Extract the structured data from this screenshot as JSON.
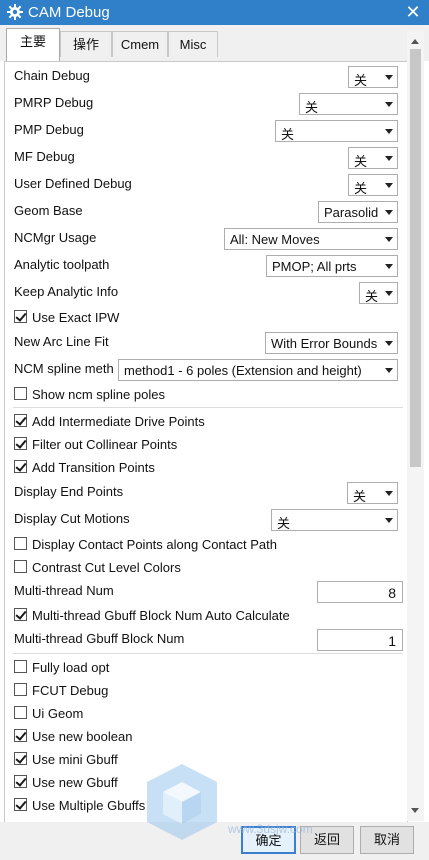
{
  "window": {
    "title": "CAM Debug",
    "accent": "#2f7fc9"
  },
  "tabs": [
    {
      "label": "主要",
      "active": true
    },
    {
      "label": "操作",
      "active": false
    },
    {
      "label": "Cmem",
      "active": false
    },
    {
      "label": "Misc",
      "active": false
    }
  ],
  "dropdown_rows": {
    "chain_debug": {
      "label": "Chain Debug",
      "value": "关"
    },
    "pmrp_debug": {
      "label": "PMRP Debug",
      "value": "关"
    },
    "pmp_debug": {
      "label": "PMP Debug",
      "value": "关"
    },
    "mf_debug": {
      "label": "MF Debug",
      "value": "关"
    },
    "user_defined_debug": {
      "label": "User Defined Debug",
      "value": "关"
    },
    "geom_base": {
      "label": "Geom Base",
      "value": "Parasolid"
    },
    "ncmgr_usage": {
      "label": "NCMgr Usage",
      "value": "All: New Moves"
    },
    "analytic_toolpath": {
      "label": "Analytic toolpath",
      "value": "PMOP; All prts"
    },
    "keep_analytic_info": {
      "label": "Keep Analytic Info",
      "value": "关"
    },
    "new_arc_line_fit": {
      "label": "New Arc Line Fit",
      "value": "With Error Bounds"
    },
    "ncm_spline_meth": {
      "label": "NCM spline meth",
      "value": "method1 - 6 poles (Extension and height)"
    },
    "display_end_points": {
      "label": "Display End Points",
      "value": "关"
    },
    "display_cut_motions": {
      "label": "Display Cut Motions",
      "value": "关"
    }
  },
  "checkboxes": {
    "use_exact_ipw": {
      "label": "Use Exact IPW",
      "checked": true
    },
    "show_ncm_spline_poles": {
      "label": "Show ncm spline poles",
      "checked": false
    },
    "add_intermediate_drive_points": {
      "label": "Add Intermediate Drive Points",
      "checked": true
    },
    "filter_out_collinear_points": {
      "label": "Filter out Collinear Points",
      "checked": true
    },
    "add_transition_points": {
      "label": "Add Transition Points",
      "checked": true
    },
    "display_contact_points": {
      "label": "Display Contact Points along Contact Path",
      "checked": false
    },
    "contrast_cut_level_colors": {
      "label": "Contrast Cut Level Colors",
      "checked": false
    },
    "multithread_gbuff_auto": {
      "label": "Multi-thread Gbuff Block Num Auto Calculate",
      "checked": true
    },
    "fully_load_opt": {
      "label": "Fully load opt",
      "checked": false
    },
    "fcut_debug": {
      "label": "FCUT Debug",
      "checked": false
    },
    "ui_geom": {
      "label": "Ui Geom",
      "checked": false
    },
    "use_new_boolean": {
      "label": "Use new boolean",
      "checked": true
    },
    "use_mini_gbuff": {
      "label": "Use mini Gbuff",
      "checked": true
    },
    "use_new_gbuff": {
      "label": "Use new Gbuff",
      "checked": true
    },
    "use_multiple_gbuffs": {
      "label": "Use Multiple Gbuffs",
      "checked": true
    }
  },
  "numeric_fields": {
    "multithread_num": {
      "label": "Multi-thread Num",
      "value": "8"
    },
    "multithread_gbuff_block_num": {
      "label": "Multi-thread Gbuff Block Num",
      "value": "1"
    }
  },
  "buttons": {
    "ok": "确定",
    "back": "返回",
    "cancel": "取消"
  },
  "watermark_text": "www.3dsjw.com"
}
